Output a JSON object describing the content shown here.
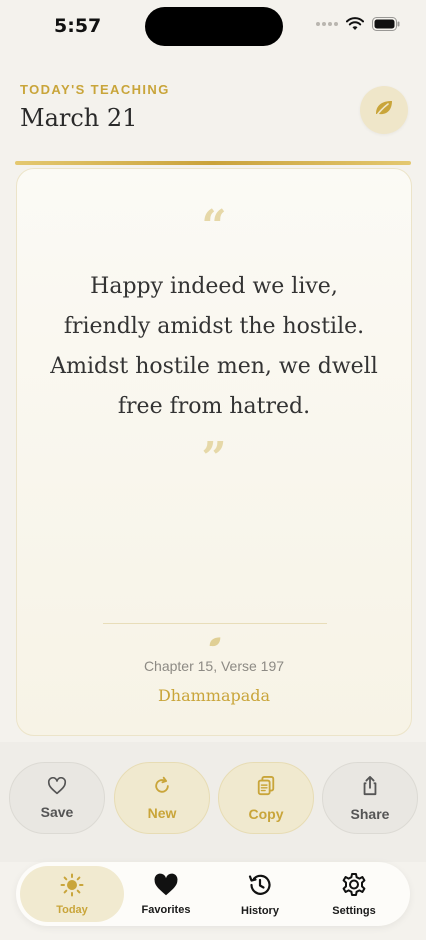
{
  "status_bar": {
    "time": "5:57"
  },
  "header": {
    "eyebrow": "TODAY'S TEACHING",
    "date": "March 21",
    "leaf_button_icon": "leaf-icon"
  },
  "quote": {
    "open_mark": "“",
    "close_mark": "”",
    "text": "Happy indeed we live, friendly amidst the hostile. Amidst hostile men, we dwell free from hatred.",
    "chapter": "Chapter 15, Verse 197",
    "source": "Dhammapada"
  },
  "actions": {
    "save": {
      "label": "Save",
      "icon": "heart-outline-icon"
    },
    "new": {
      "label": "New",
      "icon": "refresh-icon"
    },
    "copy": {
      "label": "Copy",
      "icon": "copy-icon"
    },
    "share": {
      "label": "Share",
      "icon": "share-icon"
    }
  },
  "tabs": [
    {
      "label": "Today",
      "icon": "sun-icon",
      "active": true
    },
    {
      "label": "Favorites",
      "icon": "heart-icon",
      "active": false
    },
    {
      "label": "History",
      "icon": "history-icon",
      "active": false
    },
    {
      "label": "Settings",
      "icon": "gear-icon",
      "active": false
    }
  ],
  "colors": {
    "accent": "#c9a53a",
    "background": "#f4f2ed",
    "card": "#fbfaf5"
  }
}
